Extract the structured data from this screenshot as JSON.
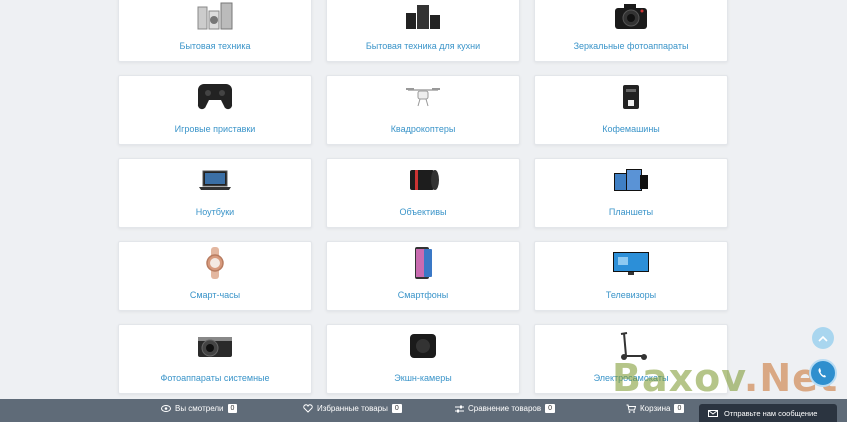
{
  "categories": [
    {
      "label": "Бытовая техника",
      "icon": "appliances-icon"
    },
    {
      "label": "Бытовая техника для кухни",
      "icon": "kitchen-appliances-icon"
    },
    {
      "label": "Зеркальные фотоаппараты",
      "icon": "dslr-camera-icon"
    },
    {
      "label": "Игровые приставки",
      "icon": "gamepad-icon"
    },
    {
      "label": "Квадрокоптеры",
      "icon": "drone-icon"
    },
    {
      "label": "Кофемашины",
      "icon": "coffee-machine-icon"
    },
    {
      "label": "Ноутбуки",
      "icon": "laptop-icon"
    },
    {
      "label": "Объективы",
      "icon": "camera-lens-icon"
    },
    {
      "label": "Планшеты",
      "icon": "tablet-icon"
    },
    {
      "label": "Смарт-часы",
      "icon": "smartwatch-icon"
    },
    {
      "label": "Смартфоны",
      "icon": "smartphone-icon"
    },
    {
      "label": "Телевизоры",
      "icon": "tv-icon"
    },
    {
      "label": "Фотоаппараты системные",
      "icon": "mirrorless-camera-icon"
    },
    {
      "label": "Экшн-камеры",
      "icon": "action-camera-icon"
    },
    {
      "label": "Электросамокаты",
      "icon": "scooter-icon"
    }
  ],
  "bottombar": {
    "viewed": {
      "label": "Вы смотрели",
      "count": "0"
    },
    "favorites": {
      "label": "Избранные товары",
      "count": "0"
    },
    "compare": {
      "label": "Сравнение товаров",
      "count": "0"
    },
    "cart": {
      "label": "Корзина",
      "count": "0"
    }
  },
  "chat": {
    "label": "Отправьте нам сообщение"
  },
  "watermark": {
    "part1": "Baxov",
    "part2": ".Net"
  }
}
